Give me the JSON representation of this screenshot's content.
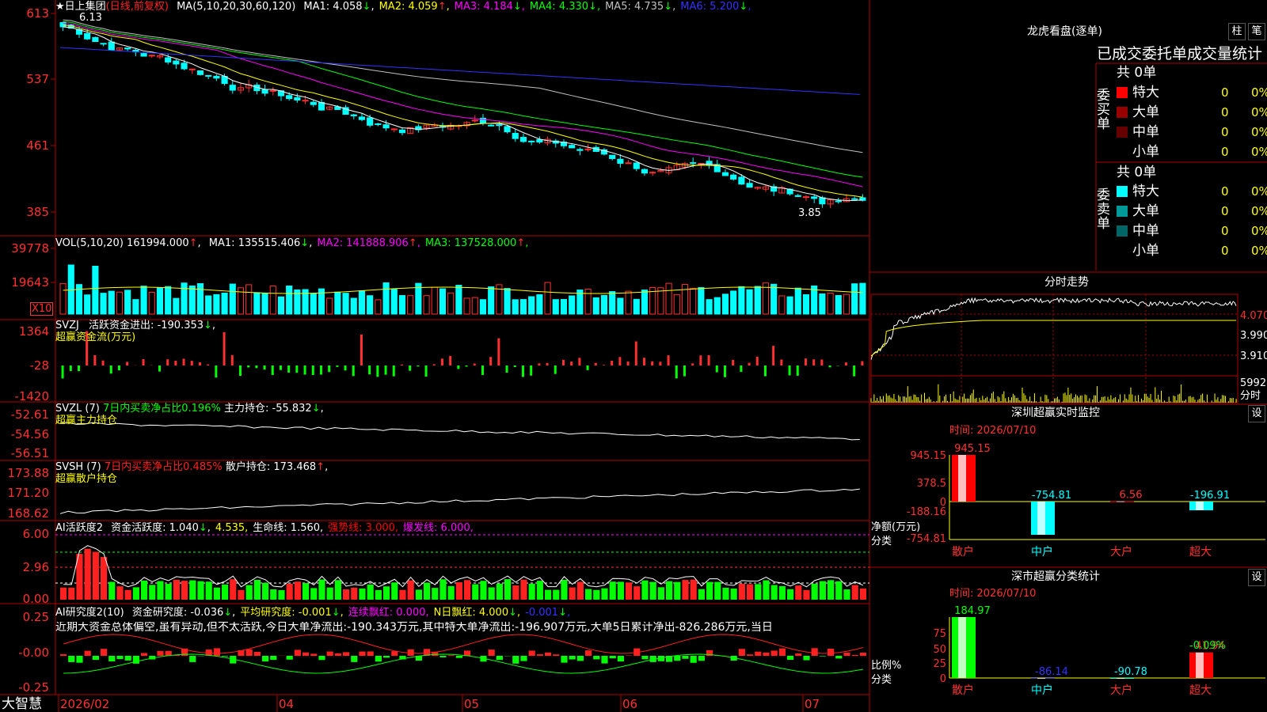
{
  "app": {
    "brand": "大智慧"
  },
  "header": {
    "star": "★",
    "stock_name": "日上集团",
    "period": "(日线,前复权)",
    "ma_title": "MA(5,10,20,30,60,120)",
    "ma_items": [
      {
        "label": "MA1:",
        "value": "4.058",
        "arrow": "↓",
        "color": "#ffffff"
      },
      {
        "label": "MA2:",
        "value": "4.059",
        "arrow": "↑",
        "color": "#ffff00"
      },
      {
        "label": "MA3:",
        "value": "4.184",
        "arrow": "↓",
        "color": "#ff00ff"
      },
      {
        "label": "MA4:",
        "value": "4.330",
        "arrow": "↓",
        "color": "#00ff00"
      },
      {
        "label": "MA5:",
        "value": "4.735",
        "arrow": "↓",
        "color": "#c0c0c0"
      },
      {
        "label": "MA6:",
        "value": "5.200",
        "arrow": "↓",
        "color": "#3333ff"
      }
    ]
  },
  "price_axis": [
    "613",
    "537",
    "461",
    "385"
  ],
  "price_marks": {
    "high": "6.13",
    "low": "3.85"
  },
  "vol": {
    "title": "VOL(5,10,20)",
    "value": "161994.000",
    "arrow": "↑",
    "items": [
      {
        "label": "MA1:",
        "value": "135515.406",
        "arrow": "↓",
        "color": "#ffffff"
      },
      {
        "label": "MA2:",
        "value": "141888.906",
        "arrow": "↑",
        "color": "#ff00ff"
      },
      {
        "label": "MA3:",
        "value": "137528.000",
        "arrow": "↑",
        "color": "#00ff00"
      }
    ],
    "axis": [
      "39778",
      "19643"
    ],
    "unit": "X10"
  },
  "svzj": {
    "title": "SVZJ",
    "label": "活跃资金进出:",
    "value": "-190.353",
    "arrow": "↓",
    "sub": "超赢资金流(万元)",
    "axis": [
      "1364",
      "-28",
      "-1420"
    ]
  },
  "svzl": {
    "title": "SVZL (7)",
    "label1": "7日内买卖净占比0.196%",
    "label2": "主力持仓:",
    "value": "-55.832",
    "arrow": "↓",
    "sub": "超赢主力持仓",
    "axis": [
      "-52.61",
      "-54.56",
      "-56.51"
    ]
  },
  "svsh": {
    "title": "SVSH (7)",
    "label1": "7日内买卖净占比0.485%",
    "label2": "散户持仓:",
    "value": "173.468",
    "arrow": "↑",
    "sub": "超赢散户持仓",
    "axis": [
      "173.88",
      "171.20",
      "168.62"
    ]
  },
  "ai_active": {
    "title": "AI活跃度2",
    "items": [
      {
        "text": "资金活跃度: 1.040",
        "arrow": "↓",
        "color": "#ffffff"
      },
      {
        "text": "4.535",
        "arrow": "",
        "color": "#ffff00"
      },
      {
        "text": "生命线: 1.560",
        "arrow": "",
        "color": "#ffffff"
      },
      {
        "text": "强势线: 3.000",
        "arrow": "",
        "color": "#ff0000"
      },
      {
        "text": "爆发线: 6.000",
        "arrow": "",
        "color": "#ff00ff"
      }
    ],
    "axis": [
      "6.00",
      "2.96",
      "0.00"
    ]
  },
  "ai_research": {
    "title": "AI研究度2(10)",
    "items": [
      {
        "text": "资金研究度: -0.036",
        "arrow": "↓",
        "color": "#ffffff"
      },
      {
        "text": "平均研究度: -0.001",
        "arrow": "↓",
        "color": "#ffff00"
      },
      {
        "text": "连续飘红: 0.000",
        "arrow": "",
        "color": "#ff00ff"
      },
      {
        "text": "N日飘红: 4.000",
        "arrow": "↓",
        "color": "#ffff00"
      },
      {
        "text": "-0.001",
        "arrow": "↓",
        "color": "#3333ff"
      }
    ],
    "comment": "近期大资金总体偏空,虽有异动,但不太活跃,今日大单净流出:-190.343万元,其中特大单净流出:-196.907万元,大单5日累计净出-826.286万元,当日",
    "axis": [
      "0.25",
      "-0.00",
      "-0.25"
    ]
  },
  "date_axis": [
    "2026/02",
    "04",
    "05",
    "06",
    "07"
  ],
  "right": {
    "lhb_title": "龙虎看盘(逐单)",
    "btn_bar": "柱",
    "btn_pen": "笔",
    "stats_title": "已成交委托单成交量统计",
    "buy_label": "委买单",
    "sell_label": "委卖单",
    "buy_total": "共 0单",
    "sell_total": "共 0单",
    "buy_rows": [
      {
        "name": "特大",
        "count": "0",
        "pct": "0%",
        "color": "#ff0000"
      },
      {
        "name": "大单",
        "count": "0",
        "pct": "0%",
        "color": "#990000"
      },
      {
        "name": "中单",
        "count": "0",
        "pct": "0%",
        "color": "#660000"
      },
      {
        "name": "小单",
        "count": "0",
        "pct": "0%",
        "color": "#000000"
      }
    ],
    "sell_rows": [
      {
        "name": "特大",
        "count": "0",
        "pct": "0%",
        "color": "#00ffff"
      },
      {
        "name": "大单",
        "count": "0",
        "pct": "0%",
        "color": "#009999"
      },
      {
        "name": "中单",
        "count": "0",
        "pct": "0%",
        "color": "#006666"
      },
      {
        "name": "小单",
        "count": "0",
        "pct": "0%",
        "color": "#000000"
      }
    ],
    "intraday": {
      "title": "分时走势",
      "axis": [
        "4.070",
        "3.990",
        "3.910"
      ],
      "vol": "5992",
      "vol_unit": "分时"
    },
    "monitor": {
      "title": "深圳超赢实时监控",
      "btn": "设",
      "time": "时间: 2026/07/10",
      "axis": [
        "945.15",
        "378.5",
        "0",
        "-188.16",
        "-754.81"
      ],
      "yunit": "净额(万元)",
      "xunit": "分类",
      "bars": [
        {
          "cat": "散户",
          "label": "945.15",
          "value": 945.15,
          "color": "#ff0000",
          "lcolor": "#ff3333"
        },
        {
          "cat": "中户",
          "label": "-754.81",
          "value": -754.81,
          "color": "#00ffff",
          "lcolor": "#00ffff"
        },
        {
          "cat": "大户",
          "label": "6.56",
          "value": 6.56,
          "color": "#ff0000",
          "lcolor": "#ff3333"
        },
        {
          "cat": "超大",
          "label": "-196.91",
          "value": -196.91,
          "color": "#00ffff",
          "lcolor": "#00ffff"
        }
      ]
    },
    "classify": {
      "title": "深市超赢分类统计",
      "btn": "设",
      "time": "时间: 2026/07/10",
      "axis": [
        "75",
        "50",
        "25",
        "0"
      ],
      "yunit": "比例%",
      "xunit": "分类",
      "bars": [
        {
          "cat": "散户",
          "label": "184.97",
          "value": 100,
          "color": "#00ff00",
          "lcolor": "#00ff00"
        },
        {
          "cat": "中户",
          "label": "-86.14",
          "value": 0,
          "color": "#3333ff",
          "lcolor": "#3333ff"
        },
        {
          "cat": "大户",
          "label": "-90.78",
          "value": 0,
          "color": "#00ffff",
          "lcolor": "#00ffff"
        },
        {
          "cat": "超大",
          "label": "41.94",
          "value": 41.94,
          "color": "#ff0000",
          "lcolor": "#ff3333"
        }
      ],
      "extra": "-0.09%"
    }
  },
  "chart_data": {
    "type": "candlestick",
    "date_labels": [
      "2026/02",
      "04",
      "05",
      "06",
      "07"
    ],
    "ylim": [
      3.85,
      6.13
    ],
    "price_ticks": [
      6.13,
      5.37,
      4.61,
      3.85
    ],
    "high": 6.13,
    "low": 3.85
  }
}
